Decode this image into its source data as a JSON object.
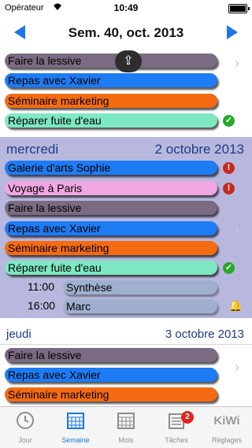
{
  "status_bar": {
    "carrier": "Opérateur",
    "time": "10:49"
  },
  "navbar": {
    "title": "Sem. 40, oct. 2013"
  },
  "tuesday_items": [
    {
      "label": "Faire la lessive",
      "color": "#7a6a82"
    },
    {
      "label": "Repas avec Xavier",
      "color": "#1d7bf4"
    },
    {
      "label": "Séminaire marketing",
      "color": "#f46b12"
    },
    {
      "label": "Réparer fuite d'eau",
      "color": "#7de8c2",
      "status": "check"
    }
  ],
  "wednesday": {
    "day": "mercredi",
    "date": "2 octobre 2013",
    "items": [
      {
        "label": "Galerie d'arts Sophie",
        "color": "#1d7bf4",
        "status": "alert"
      },
      {
        "label": "Voyage à Paris",
        "color": "#f2a7e2",
        "status": "alert"
      },
      {
        "label": "Faire la lessive",
        "color": "#7a6a82"
      },
      {
        "label": "Repas avec Xavier",
        "color": "#1d7bf4"
      },
      {
        "label": "Séminaire marketing",
        "color": "#f46b12"
      },
      {
        "label": "Réparer fuite d'eau",
        "color": "#7de8c2",
        "status": "check"
      }
    ],
    "timed": [
      {
        "time": "11:00",
        "label": "Synthèse"
      },
      {
        "time": "16:00",
        "label": "Marc",
        "icon": "bell-icon"
      }
    ]
  },
  "thursday": {
    "day": "jeudi",
    "date": "3 octobre 2013",
    "items": [
      {
        "label": "Faire la lessive",
        "color": "#7a6a82"
      },
      {
        "label": "Repas avec Xavier",
        "color": "#1d7bf4"
      },
      {
        "label": "Séminaire marketing",
        "color": "#f46b12"
      }
    ]
  },
  "tabbar": {
    "tabs": [
      {
        "label": "Jour",
        "icon": "clock-icon"
      },
      {
        "label": "Semaine",
        "icon": "calendar-week-icon",
        "active": true
      },
      {
        "label": "Mois",
        "icon": "calendar-month-icon"
      },
      {
        "label": "Tâches",
        "icon": "tasks-icon",
        "badge": "2"
      },
      {
        "label": "Réglages",
        "icon": "kiwi-logo",
        "logo_text": "KiWi"
      }
    ]
  },
  "colors": {
    "accent": "#1a78e6",
    "day_band": "#b8b8de",
    "day_text": "#1d3c84"
  }
}
